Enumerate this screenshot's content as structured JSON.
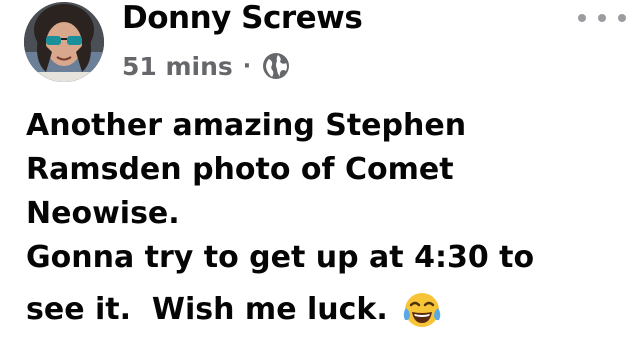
{
  "post": {
    "author": "Donny Screws",
    "time": "51 mins",
    "separator": "·",
    "audience_icon": "globe-icon",
    "more_icon": "more-horizontal-icon",
    "body_lines": [
      "Another amazing Stephen",
      "Ramsden photo of Comet",
      "Neowise.",
      "Gonna try to get up at 4:30 to",
      "see it.  Wish me luck."
    ],
    "emoji": "face-with-tears-of-joy-icon"
  },
  "colors": {
    "text": "#050505",
    "meta": "#65676b",
    "more_dots": "#9a9ca0",
    "background": "#ffffff"
  }
}
